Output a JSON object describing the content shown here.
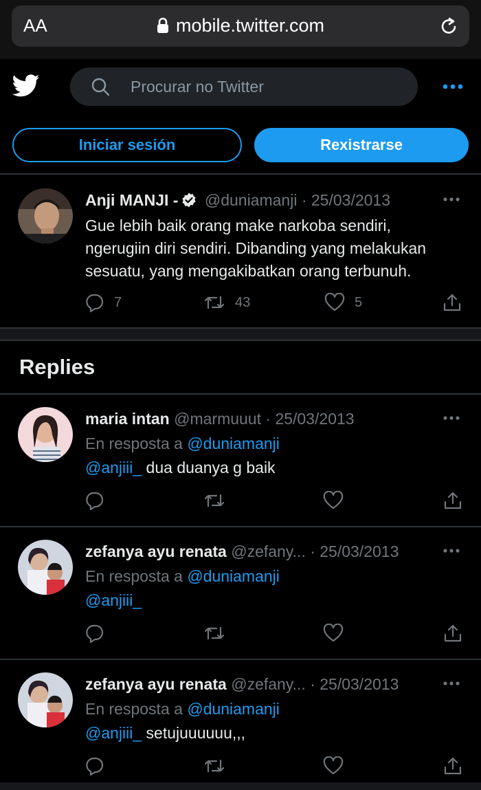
{
  "browser": {
    "aa_label": "AA",
    "url": "mobile.twitter.com"
  },
  "header": {
    "search_placeholder": "Procurar no Twitter"
  },
  "auth": {
    "login_label": "Iniciar sesión",
    "signup_label": "Rexistrarse"
  },
  "main_tweet": {
    "name": "Anji MANJI -",
    "handle": "@duniamanji",
    "separator": "·",
    "date": "25/03/2013",
    "text": "Gue lebih baik orang make narkoba sendiri, ngerugiin diri sendiri. Dibanding yang melakukan sesuatu, yang mengakibatkan orang terbunuh.",
    "reply_count": "7",
    "retweet_count": "43",
    "like_count": "5"
  },
  "replies_title": "Replies",
  "replies": [
    {
      "name": "maria intan",
      "handle": "@marmuuut",
      "separator": "·",
      "date": "25/03/2013",
      "reply_to_prefix": "En resposta a",
      "reply_to_handle": "@duniamanji",
      "mention": "@anjiii_",
      "text": " dua duanya g baik"
    },
    {
      "name": "zefanya ayu renata",
      "handle": "@zefany...",
      "separator": "·",
      "date": "25/03/2013",
      "reply_to_prefix": "En resposta a",
      "reply_to_handle": "@duniamanji",
      "mention": "@anjiii_",
      "text": ""
    },
    {
      "name": "zefanya ayu renata",
      "handle": "@zefany...",
      "separator": "·",
      "date": "25/03/2013",
      "reply_to_prefix": "En resposta a",
      "reply_to_handle": "@duniamanji",
      "mention": "@anjiii_",
      "text": " setujuuuuuu,,,"
    }
  ],
  "colors": {
    "accent": "#1d9bf0",
    "background": "#000000",
    "muted_text": "#71767b",
    "divider": "#2f3336"
  },
  "icons": {
    "header": [
      "twitter-bird-icon",
      "search-icon",
      "more-icon"
    ],
    "browser": [
      "lock-icon",
      "reload-icon"
    ],
    "tweet_actions": [
      "reply-icon",
      "retweet-icon",
      "like-icon",
      "share-icon"
    ]
  }
}
